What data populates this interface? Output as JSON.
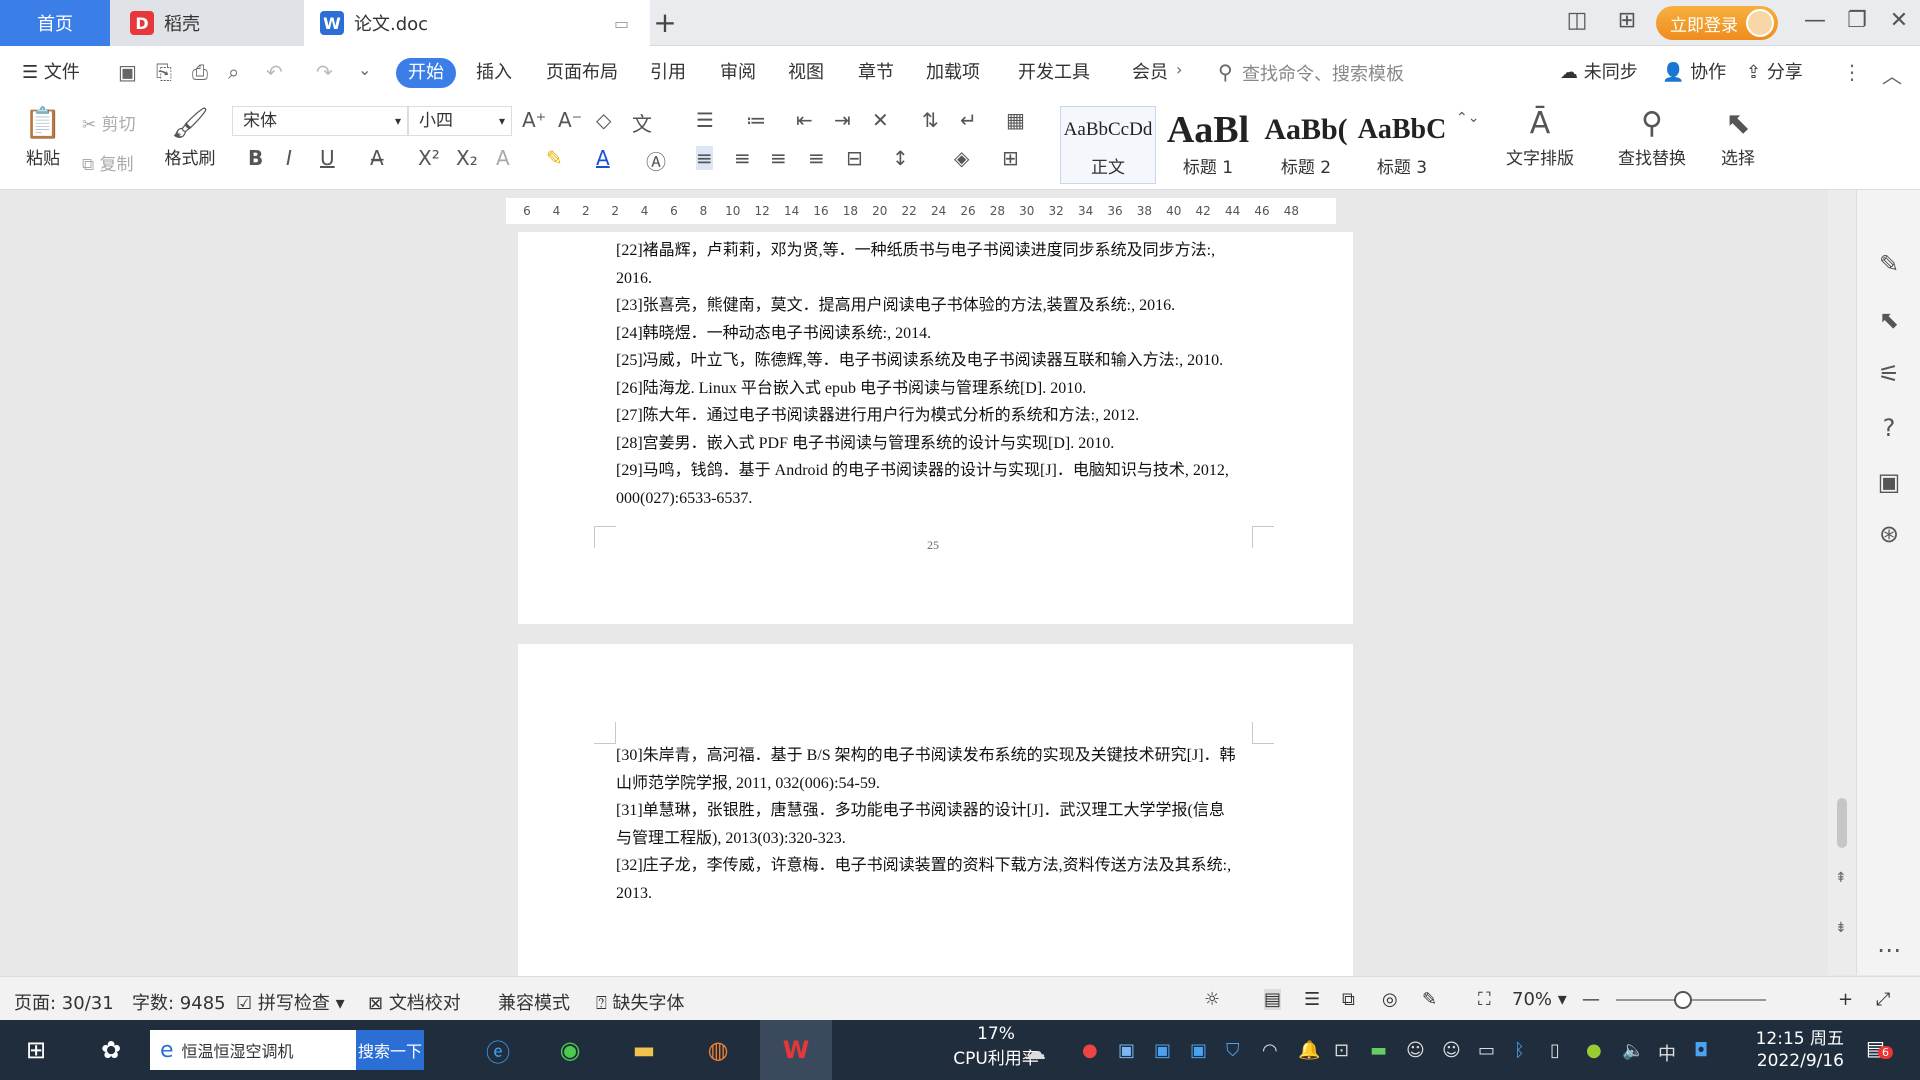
{
  "tabs": {
    "home": "首页",
    "daoke": "稻壳",
    "doc": "论文.doc"
  },
  "topright": {
    "login": "立即登录"
  },
  "menu": {
    "file": "文件",
    "items": [
      "开始",
      "插入",
      "页面布局",
      "引用",
      "审阅",
      "视图",
      "章节",
      "加载项",
      "开发工具",
      "会员"
    ],
    "search_placeholder": "查找命令、搜索模板",
    "sync": "未同步",
    "collab": "协作",
    "share": "分享"
  },
  "ribbon": {
    "paste": "粘贴",
    "cut": "剪切",
    "copy": "复制",
    "format_painter": "格式刷",
    "font": "宋体",
    "size": "小四",
    "styles": [
      {
        "preview": "AaBbCcDd",
        "name": "正文"
      },
      {
        "preview": "AaBl",
        "name": "标题 1"
      },
      {
        "preview": "AaBb(",
        "name": "标题 2"
      },
      {
        "preview": "AaBbC",
        "name": "标题 3"
      }
    ],
    "text_layout": "文字排版",
    "find_replace": "查找替换",
    "select": "选择"
  },
  "ruler": [
    "6",
    "4",
    "2",
    "2",
    "4",
    "6",
    "8",
    "10",
    "12",
    "14",
    "16",
    "18",
    "20",
    "22",
    "24",
    "26",
    "28",
    "30",
    "32",
    "34",
    "36",
    "38",
    "40",
    "42",
    "44",
    "46",
    "48"
  ],
  "page1": {
    "refs": [
      "[22]褚晶辉，卢莉莉，邓为贤,等．一种纸质书与电子书阅读进度同步系统及同步方法:,",
      "2016.",
      "[23]张喜亮，熊健南，莫文．提高用户阅读电子书体验的方法,装置及系统:, 2016.",
      "[24]韩晓煜．一种动态电子书阅读系统:, 2014.",
      "[25]冯威，叶立飞，陈德辉,等．电子书阅读系统及电子书阅读器互联和输入方法:, 2010.",
      "[26]陆海龙. Linux 平台嵌入式 epub 电子书阅读与管理系统[D].    2010.",
      "[27]陈大年．通过电子书阅读器进行用户行为模式分析的系统和方法:, 2012.",
      "[28]宫姜男．嵌入式 PDF 电子书阅读与管理系统的设计与实现[D].    2010.",
      "[29]马鸣，钱鸽．基于 Android 的电子书阅读器的设计与实现[J]．电脑知识与技术, 2012,",
      "000(027):6533-6537."
    ],
    "page_number": "25"
  },
  "page2": {
    "refs": [
      "[30]朱岸青，高河福．基于 B/S 架构的电子书阅读发布系统的实现及关键技术研究[J]．韩",
      "山师范学院学报, 2011, 032(006):54-59.",
      "[31]单慧琳，张银胜，唐慧强．多功能电子书阅读器的设计[J]．武汉理工大学学报(信息",
      "与管理工程版), 2013(03):320-323.",
      "[32]庄子龙，李传威，许意梅．电子书阅读装置的资料下载方法,资料传送方法及其系统:,",
      "2013."
    ]
  },
  "status": {
    "page": "页面: 30/31",
    "words": "字数: 9485",
    "spell": "拼写检查",
    "proof": "文档校对",
    "compat": "兼容模式",
    "missing_font": "缺失字体",
    "zoom": "70%"
  },
  "taskbar": {
    "search_text": "恒温恒湿空调机",
    "search_btn": "搜索一下",
    "cpu_pct": "17%",
    "cpu_label": "CPU利用率",
    "ime": "中",
    "time": "12:15 周五",
    "date": "2022/9/16",
    "notif": "6"
  }
}
